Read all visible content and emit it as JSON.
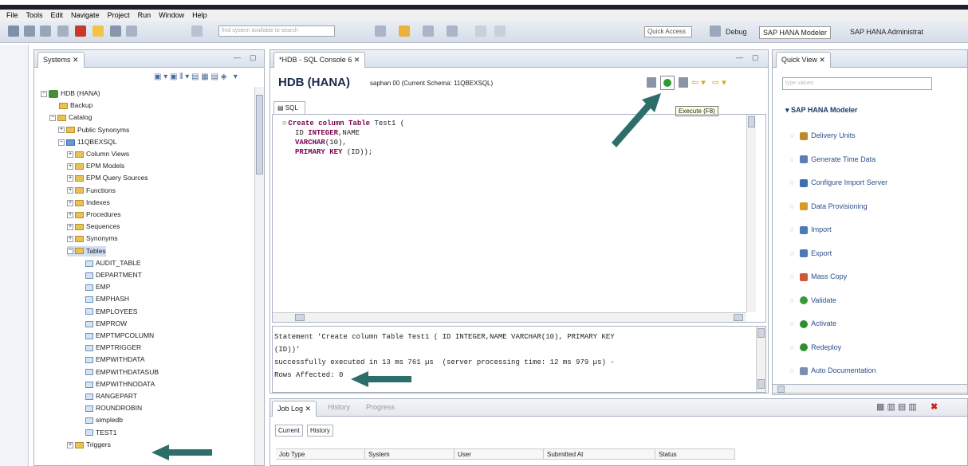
{
  "menu": [
    "File",
    "Tools",
    "Edit",
    "Navigate",
    "Project",
    "Run",
    "Window",
    "Help"
  ],
  "toolbar": {
    "search_placeholder": "find system available to search",
    "quick_access": "Quick Access",
    "perspectives": [
      "Debug",
      "SAP HANA Modeler",
      "SAP HANA Administrat"
    ]
  },
  "systems_panel": {
    "tab_label": "Systems",
    "tree": [
      {
        "label": "HDB (HANA)",
        "indent": 0,
        "kind": "db",
        "exp": "−"
      },
      {
        "label": "Backup",
        "indent": 1,
        "kind": "backup",
        "exp": ""
      },
      {
        "label": "Catalog",
        "indent": 1,
        "kind": "folder",
        "exp": "−"
      },
      {
        "label": "Public Synonyms",
        "indent": 2,
        "kind": "folder",
        "exp": "+"
      },
      {
        "label": "11QBEXSQL",
        "indent": 2,
        "kind": "schema",
        "exp": "−"
      },
      {
        "label": "Column Views",
        "indent": 3,
        "kind": "folder",
        "exp": "+"
      },
      {
        "label": "EPM Models",
        "indent": 3,
        "kind": "folder",
        "exp": "+"
      },
      {
        "label": "EPM Query Sources",
        "indent": 3,
        "kind": "folder",
        "exp": "+"
      },
      {
        "label": "Functions",
        "indent": 3,
        "kind": "folder",
        "exp": "+"
      },
      {
        "label": "Indexes",
        "indent": 3,
        "kind": "folder",
        "exp": "+"
      },
      {
        "label": "Procedures",
        "indent": 3,
        "kind": "folder",
        "exp": "+"
      },
      {
        "label": "Sequences",
        "indent": 3,
        "kind": "folder",
        "exp": "+"
      },
      {
        "label": "Synonyms",
        "indent": 3,
        "kind": "folder",
        "exp": "+"
      },
      {
        "label": "Tables",
        "indent": 3,
        "kind": "folder",
        "exp": "−",
        "selected": true
      },
      {
        "label": "AUDIT_TABLE",
        "indent": 4,
        "kind": "table",
        "exp": ""
      },
      {
        "label": "DEPARTMENT",
        "indent": 4,
        "kind": "table",
        "exp": ""
      },
      {
        "label": "EMP",
        "indent": 4,
        "kind": "table",
        "exp": ""
      },
      {
        "label": "EMPHASH",
        "indent": 4,
        "kind": "table",
        "exp": ""
      },
      {
        "label": "EMPLOYEES",
        "indent": 4,
        "kind": "table",
        "exp": ""
      },
      {
        "label": "EMPROW",
        "indent": 4,
        "kind": "table",
        "exp": ""
      },
      {
        "label": "EMPTMPCOLUMN",
        "indent": 4,
        "kind": "table",
        "exp": ""
      },
      {
        "label": "EMPTRIGGER",
        "indent": 4,
        "kind": "table",
        "exp": ""
      },
      {
        "label": "EMPWITHDATA",
        "indent": 4,
        "kind": "table",
        "exp": ""
      },
      {
        "label": "EMPWITHDATASUB",
        "indent": 4,
        "kind": "table",
        "exp": ""
      },
      {
        "label": "EMPWITHNODATA",
        "indent": 4,
        "kind": "table",
        "exp": ""
      },
      {
        "label": "RANGEPART",
        "indent": 4,
        "kind": "table",
        "exp": ""
      },
      {
        "label": "ROUNDROBIN",
        "indent": 4,
        "kind": "table",
        "exp": ""
      },
      {
        "label": "simpledb",
        "indent": 4,
        "kind": "table",
        "exp": ""
      },
      {
        "label": "TEST1",
        "indent": 4,
        "kind": "table",
        "exp": ""
      },
      {
        "label": "Triggers",
        "indent": 3,
        "kind": "folder",
        "exp": "+"
      }
    ]
  },
  "sql_console": {
    "tab_label": "*HDB - SQL Console 6",
    "header_title": "HDB (HANA)",
    "header_sub": "saphan 00 (Current Schema: 11QBEXSQL)",
    "execute_tooltip": "Execute (F8)",
    "editor_tab": "SQL",
    "code_lines": [
      [
        {
          "t": "Create column Table ",
          "k": true
        },
        {
          "t": "Test1 (",
          "k": false
        }
      ],
      [
        {
          "t": "ID ",
          "k": false
        },
        {
          "t": "INTEGER",
          "k": true
        },
        {
          "t": ",NAME",
          "k": false
        }
      ],
      [
        {
          "t": "VARCHAR",
          "k": true
        },
        {
          "t": "(10),",
          "k": false
        }
      ],
      [
        {
          "t": "PRIMARY KEY ",
          "k": true
        },
        {
          "t": "(ID));",
          "k": false
        }
      ]
    ],
    "result_lines": [
      "Statement 'Create column Table Test1 ( ID INTEGER,NAME VARCHAR(10), PRIMARY KEY",
      "(ID))'",
      "successfully executed in 13 ms 761 µs  (server processing time: 12 ms 979 µs) -",
      "Rows Affected: 0"
    ]
  },
  "quick_view": {
    "tab_label": "Quick View",
    "filter_placeholder": "type values",
    "section": "SAP HANA Modeler",
    "items": [
      {
        "label": "Delivery Units",
        "icon": "delivery-units-icon",
        "color": "#c08a2a"
      },
      {
        "label": "Generate Time Data",
        "icon": "time-data-icon",
        "color": "#5a7fb8"
      },
      {
        "label": "Configure Import Server",
        "icon": "import-server-icon",
        "color": "#3d6fb0"
      },
      {
        "label": "Data Provisioning",
        "icon": "data-provisioning-icon",
        "color": "#d89a2a"
      },
      {
        "label": "Import",
        "icon": "import-icon",
        "color": "#4a7ab8"
      },
      {
        "label": "Export",
        "icon": "export-icon",
        "color": "#4a7ab8"
      },
      {
        "label": "Mass Copy",
        "icon": "mass-copy-icon",
        "color": "#d0583a"
      },
      {
        "label": "Validate",
        "icon": "validate-icon",
        "color": "#3a9a3a"
      },
      {
        "label": "Activate",
        "icon": "activate-icon",
        "color": "#2f8f2f"
      },
      {
        "label": "Redeploy",
        "icon": "redeploy-icon",
        "color": "#2f8f2f"
      },
      {
        "label": "Auto Documentation",
        "icon": "auto-doc-icon",
        "color": "#7a8fb0"
      }
    ]
  },
  "job_log": {
    "tabs": [
      "Job Log",
      "History",
      "Progress"
    ],
    "subtabs": [
      "Current",
      "History"
    ],
    "columns": [
      "Job Type",
      "System",
      "User",
      "Submitted At",
      "Status"
    ]
  },
  "colors": {
    "accent_arrow": "#2e6e6a",
    "keyword": "#7a0052"
  }
}
